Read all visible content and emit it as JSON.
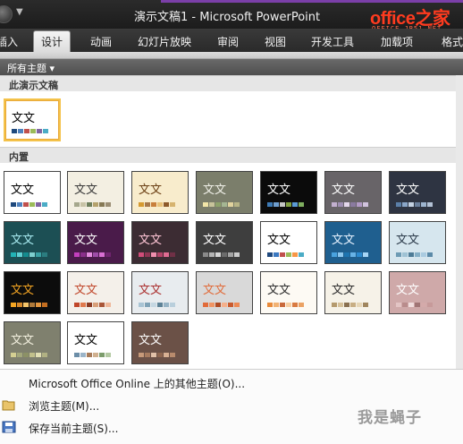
{
  "window": {
    "title": "演示文稿1 - Microsoft PowerPoint",
    "quick_access_arrow": "▼"
  },
  "logo": {
    "main": "office之家",
    "sub": "OFFICE.JB51.NET"
  },
  "ribbon": {
    "tabs": [
      {
        "label": "插入",
        "active": false
      },
      {
        "label": "设计",
        "active": true
      },
      {
        "label": "动画",
        "active": false
      },
      {
        "label": "幻灯片放映",
        "active": false
      },
      {
        "label": "审阅",
        "active": false
      },
      {
        "label": "视图",
        "active": false
      },
      {
        "label": "开发工具",
        "active": false
      },
      {
        "label": "加载项",
        "active": false
      },
      {
        "label": "格式",
        "active": false
      }
    ]
  },
  "gallery": {
    "header": "所有主题 ▾",
    "section_current": "此演示文稿",
    "section_builtin": "内置",
    "themes": [
      {
        "text": "文文",
        "bg": "#ffffff",
        "fg": "#000000",
        "swatches": [
          "#1f497d",
          "#4f81bd",
          "#c0504d",
          "#9bbb59",
          "#8064a2",
          "#4bacc6"
        ]
      },
      {
        "text": "文文",
        "bg": "#ffffff",
        "fg": "#000000",
        "swatches": [
          "#1f497d",
          "#4f81bd",
          "#c0504d",
          "#9bbb59",
          "#8064a2",
          "#4bacc6"
        ]
      },
      {
        "text": "文文",
        "bg": "#f3efe2",
        "fg": "#3a3a3a",
        "swatches": [
          "#a5a78c",
          "#c8c3a6",
          "#6e7f5c",
          "#b5a26c",
          "#867955",
          "#9b8e74"
        ]
      },
      {
        "text": "文文",
        "bg": "#f8eccc",
        "fg": "#6a3e12",
        "swatches": [
          "#d69a30",
          "#a6784a",
          "#c87f3c",
          "#e8c27a",
          "#8d5a2b",
          "#d6b36e"
        ]
      },
      {
        "text": "文文",
        "bg": "#7b7e6b",
        "fg": "#f0f0e8",
        "swatches": [
          "#f2e6a8",
          "#c8c49b",
          "#8da26b",
          "#a5b693",
          "#e1d39e",
          "#b8b587"
        ]
      },
      {
        "text": "文文",
        "bg": "#0b0b0b",
        "fg": "#ffffff",
        "swatches": [
          "#3d7ab5",
          "#6f9fd0",
          "#c5c5c5",
          "#80a040",
          "#5b9bd5",
          "#7faf5f"
        ]
      },
      {
        "text": "文文",
        "bg": "#686468",
        "fg": "#ffffff",
        "swatches": [
          "#c3b0d0",
          "#9f8fb3",
          "#e4d7ec",
          "#8a7aa0",
          "#b39bc7",
          "#d1c3de"
        ]
      },
      {
        "text": "文文",
        "bg": "#2e3442",
        "fg": "#ffffff",
        "swatches": [
          "#5b7fa8",
          "#8aa6c8",
          "#c4d2e3",
          "#6a7f9c",
          "#9db4cf",
          "#b3c2d6"
        ]
      },
      {
        "text": "文文",
        "bg": "#1c4f54",
        "fg": "#a9ecf2",
        "swatches": [
          "#22b3b6",
          "#5fd0d3",
          "#148c8f",
          "#7ecfcf",
          "#3aa1a4",
          "#2b7d80"
        ]
      },
      {
        "text": "文文",
        "bg": "#4a1b4a",
        "fg": "#ffffff",
        "swatches": [
          "#c33fbd",
          "#8a2f8a",
          "#e58de0",
          "#9e4da8",
          "#d86fd3",
          "#702470"
        ]
      },
      {
        "text": "文文",
        "bg": "#3c2c33",
        "fg": "#ffc6d6",
        "swatches": [
          "#d04d79",
          "#8f3553",
          "#f08fae",
          "#b4456a",
          "#e06c92",
          "#703046"
        ]
      },
      {
        "text": "文文",
        "bg": "#3e3e3e",
        "fg": "#ffffff",
        "swatches": [
          "#8a8a8a",
          "#b5b5b5",
          "#d7d7d7",
          "#6c6c6c",
          "#a4a4a4",
          "#cccccc"
        ]
      },
      {
        "text": "文文",
        "bg": "#ffffff",
        "fg": "#000000",
        "swatches": [
          "#1f497d",
          "#3b79c1",
          "#c0504d",
          "#9bbb59",
          "#f79646",
          "#4bacc6"
        ]
      },
      {
        "text": "文文",
        "bg": "#1f5f8f",
        "fg": "#e6f2ff",
        "swatches": [
          "#4aa3df",
          "#8cc7ee",
          "#1d74b0",
          "#67b2e6",
          "#2b8ad0",
          "#a6d5f5"
        ]
      },
      {
        "text": "文文",
        "bg": "#d6e6ee",
        "fg": "#2b3a4a",
        "swatches": [
          "#6d9bb4",
          "#9fc2d4",
          "#4d7b96",
          "#84afc6",
          "#aacbe0",
          "#5b8aa8"
        ]
      },
      {
        "text": "文文",
        "bg": "#0c0c0c",
        "fg": "#f5a623",
        "swatches": [
          "#f5a623",
          "#d8892a",
          "#f7c66a",
          "#b07a3a",
          "#e4963e",
          "#c46e20"
        ]
      },
      {
        "text": "文文",
        "bg": "#f4f0ea",
        "fg": "#c0462a",
        "swatches": [
          "#c0462a",
          "#e07a4e",
          "#8b3b24",
          "#d9a07a",
          "#a95638",
          "#efb89a"
        ]
      },
      {
        "text": "文文",
        "bg": "#e8ecef",
        "fg": "#aa2e2e",
        "swatches": [
          "#a9c4d4",
          "#7fa2b6",
          "#c5d7e2",
          "#5e8296",
          "#96b3c5",
          "#b9cfdc"
        ]
      },
      {
        "text": "文文",
        "bg": "#d9d9d9",
        "fg": "#e16b3a",
        "swatches": [
          "#e16b3a",
          "#f09463",
          "#b04a22",
          "#f5b08b",
          "#c95b2e",
          "#ed8a55"
        ]
      },
      {
        "text": "文文",
        "bg": "#fdfaf4",
        "fg": "#2b2b2b",
        "swatches": [
          "#e88a3a",
          "#f2b273",
          "#c9693c",
          "#f7cfa3",
          "#d97b42",
          "#eba264"
        ]
      },
      {
        "text": "文文",
        "bg": "#f6f2e8",
        "fg": "#2b2b2b",
        "swatches": [
          "#b59a6e",
          "#d6c19a",
          "#8a7050",
          "#c8ae84",
          "#e6d6b6",
          "#a0865e"
        ]
      },
      {
        "text": "文文",
        "bg": "#cfa9a9",
        "fg": "#ffffff",
        "swatches": [
          "#e3c4c4",
          "#b98c8c",
          "#f0dede",
          "#a07575",
          "#d4aaaa",
          "#c79a9a"
        ]
      },
      {
        "text": "文文",
        "bg": "#7f806e",
        "fg": "#f4f1e0",
        "swatches": [
          "#d4cf92",
          "#a3a77b",
          "#8c9166",
          "#c2c08b",
          "#e3e0b4",
          "#b1b183"
        ]
      },
      {
        "text": "文文",
        "bg": "#ffffff",
        "fg": "#000000",
        "swatches": [
          "#6c8ea8",
          "#9bb4c8",
          "#a77b5a",
          "#d0b08f",
          "#7c9c6c",
          "#b3c9a2"
        ]
      },
      {
        "text": "文文",
        "bg": "#6b5147",
        "fg": "#ffffff",
        "swatches": [
          "#c79a7a",
          "#a77b5f",
          "#e1c1a8",
          "#8e6650",
          "#d8b194",
          "#b88b6d"
        ]
      }
    ]
  },
  "menu": {
    "online": "Microsoft Office Online 上的其他主题(O)...",
    "browse": "浏览主题(M)...",
    "save": "保存当前主题(S)..."
  },
  "watermark": "我是蝇子"
}
